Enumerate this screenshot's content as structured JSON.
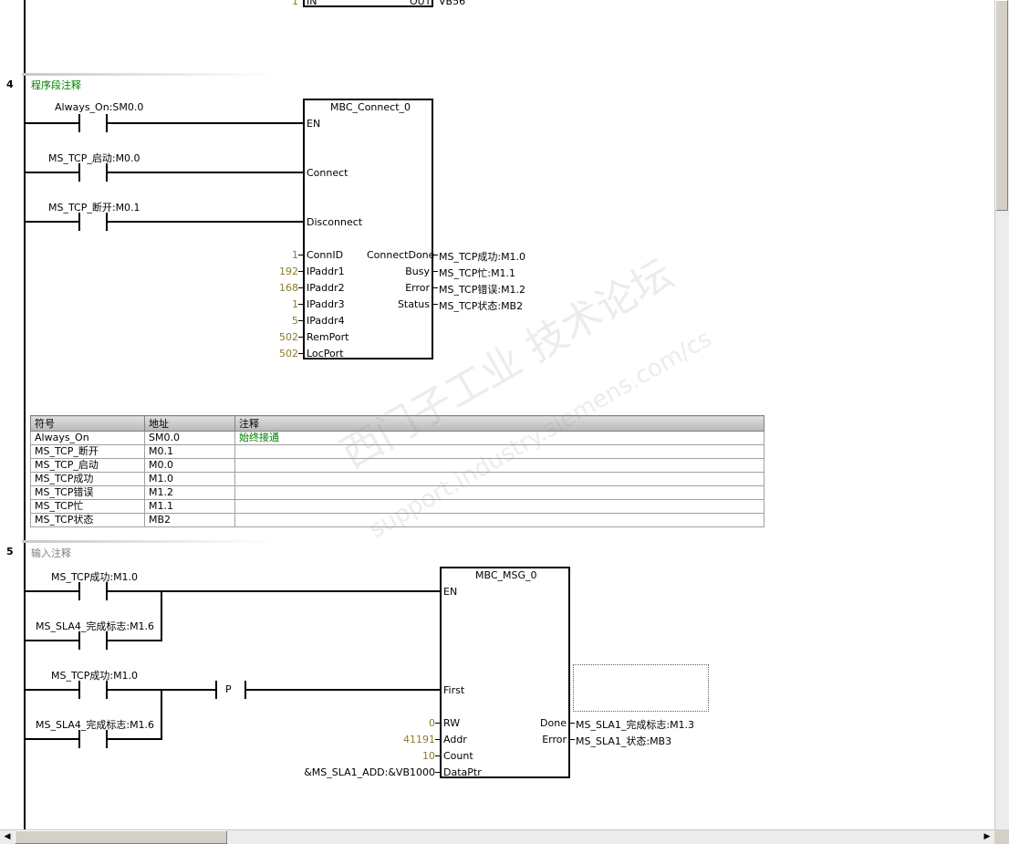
{
  "top_fragment": {
    "in_value": "1",
    "in_label": "IN",
    "out_label": "OUT",
    "out_value": "VB56"
  },
  "network4": {
    "number": "4",
    "comment": "程序段注释",
    "block_title": "MBC_Connect_0",
    "contacts": [
      "Always_On:SM0.0",
      "MS_TCP_启动:M0.0",
      "MS_TCP_断开:M0.1"
    ],
    "inputs": [
      "EN",
      "Connect",
      "Disconnect"
    ],
    "params": [
      {
        "value": "1",
        "name": "ConnID"
      },
      {
        "value": "192",
        "name": "IPaddr1"
      },
      {
        "value": "168",
        "name": "IPaddr2"
      },
      {
        "value": "1",
        "name": "IPaddr3"
      },
      {
        "value": "5",
        "name": "IPaddr4"
      },
      {
        "value": "502",
        "name": "RemPort"
      },
      {
        "value": "502",
        "name": "LocPort"
      }
    ],
    "outputs": [
      {
        "name": "ConnectDone",
        "value": "MS_TCP成功:M1.0"
      },
      {
        "name": "Busy",
        "value": "MS_TCP忙:M1.1"
      },
      {
        "name": "Error",
        "value": "MS_TCP错误:M1.2"
      },
      {
        "name": "Status",
        "value": "MS_TCP状态:MB2"
      }
    ]
  },
  "symbol_table": {
    "headers": [
      "符号",
      "地址",
      "注释"
    ],
    "rows": [
      [
        "Always_On",
        "SM0.0",
        "始终接通"
      ],
      [
        "MS_TCP_断开",
        "M0.1",
        ""
      ],
      [
        "MS_TCP_启动",
        "M0.0",
        ""
      ],
      [
        "MS_TCP成功",
        "M1.0",
        ""
      ],
      [
        "MS_TCP错误",
        "M1.2",
        ""
      ],
      [
        "MS_TCP忙",
        "M1.1",
        ""
      ],
      [
        "MS_TCP状态",
        "MB2",
        ""
      ]
    ],
    "comment_color": "#008000"
  },
  "network5": {
    "number": "5",
    "comment": "输入注释",
    "block_title": "MBC_MSG_0",
    "contacts": [
      "MS_TCP成功:M1.0",
      "MS_SLA4_完成标志:M1.6",
      "MS_TCP成功:M1.0",
      "MS_SLA4_完成标志:M1.6"
    ],
    "p_label": "P",
    "inputs": [
      "EN",
      "First"
    ],
    "params": [
      {
        "value": "0",
        "name": "RW"
      },
      {
        "value": "41191",
        "name": "Addr"
      },
      {
        "value": "10",
        "name": "Count"
      },
      {
        "value": "&MS_SLA1_ADD:&VB1000",
        "name": "DataPtr"
      }
    ],
    "outputs": [
      {
        "name": "Done",
        "value": "MS_SLA1_完成标志:M1.3"
      },
      {
        "name": "Error",
        "value": "MS_SLA1_状态:MB3"
      }
    ]
  },
  "watermark": {
    "line1": "西门子工业  技术论坛",
    "line2": "support.industry.siemens.com/cs"
  },
  "colors": {
    "constant": "#8c7a2c",
    "comment4": "#008000",
    "comment5": "#808080"
  }
}
